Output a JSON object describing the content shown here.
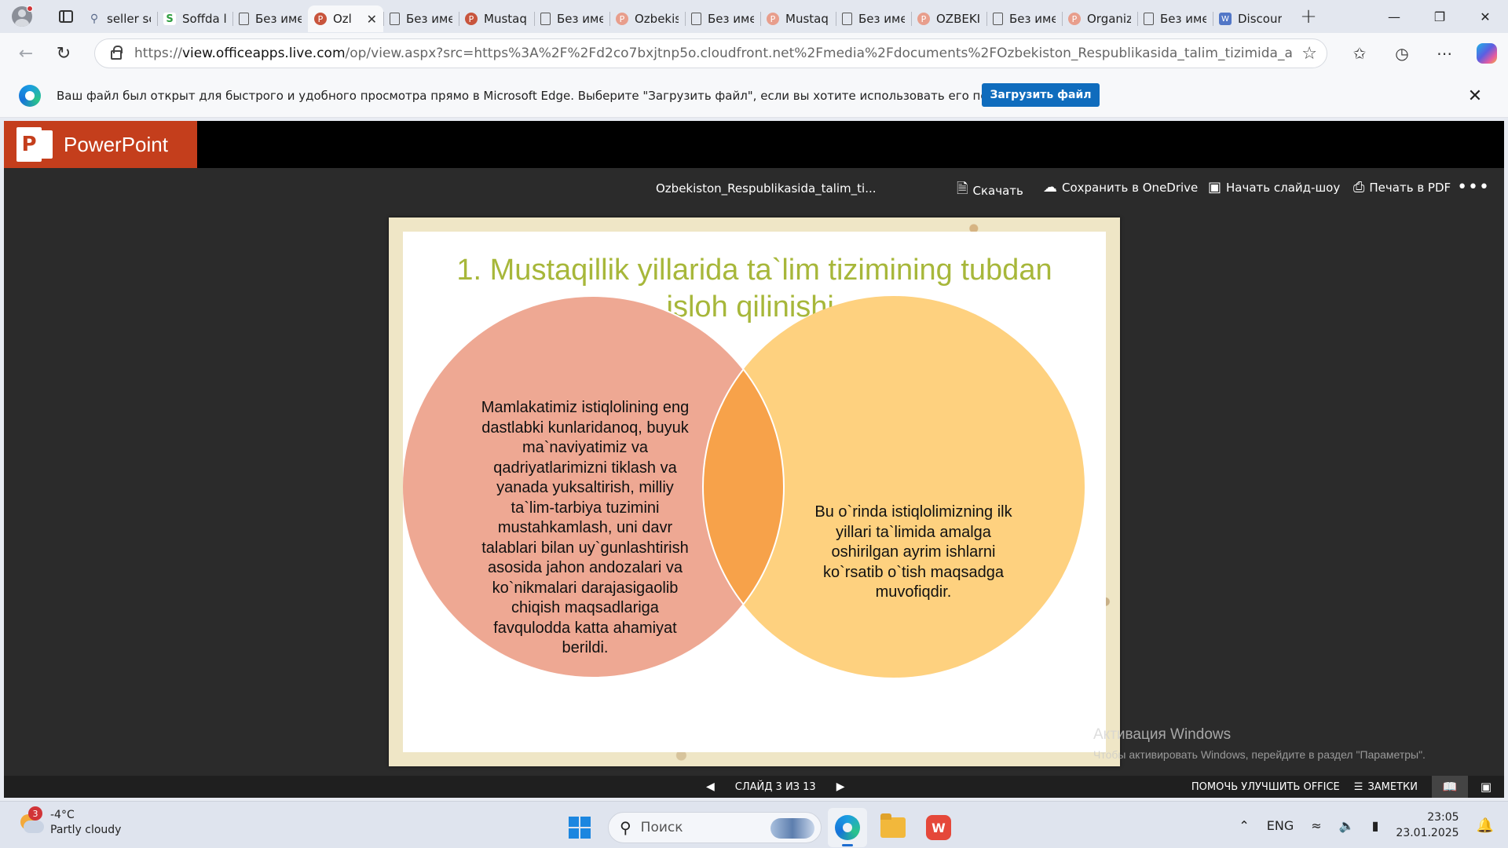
{
  "browser": {
    "tabs": [
      {
        "label": "seller sc",
        "icon": "search"
      },
      {
        "label": "Soffda l",
        "icon": "soffda"
      },
      {
        "label": "Без име",
        "icon": "doc"
      },
      {
        "label": "Ozl",
        "icon": "ppt",
        "active": true
      },
      {
        "label": "Без име",
        "icon": "doc"
      },
      {
        "label": "Mustaq",
        "icon": "ppt"
      },
      {
        "label": "Без име",
        "icon": "doc"
      },
      {
        "label": "Ozbekis",
        "icon": "pptpale"
      },
      {
        "label": "Без име",
        "icon": "doc"
      },
      {
        "label": "Mustaq",
        "icon": "pptpale"
      },
      {
        "label": "Без име",
        "icon": "doc"
      },
      {
        "label": "OZBEKI",
        "icon": "pptpale"
      },
      {
        "label": "Без име",
        "icon": "doc"
      },
      {
        "label": "Organiz",
        "icon": "pptpale"
      },
      {
        "label": "Без име",
        "icon": "doc"
      },
      {
        "label": "Discour",
        "icon": "word"
      }
    ],
    "new_tab": "+",
    "url_prefix": "https://",
    "url_host": "view.officeapps.live.com",
    "url_rest": "/op/view.aspx?src=https%3A%2F%2Fd2co7bxjtnp5o.cloudfront.net%2Fmedia%2Fdocuments%2FOzbekiston_Respublikasida_talim_tizimida_amalga_oshiril..."
  },
  "infobar": {
    "message": "Ваш файл был открыт для быстрого и удобного просмотра прямо в Microsoft Edge. Выберите \"Загрузить файл\", если вы хотите использовать его позже.",
    "button": "Загрузить файл"
  },
  "ppt": {
    "app_name": "PowerPoint",
    "doc_name": "Ozbekiston_Respublikasida_talim_ti...",
    "actions": {
      "download": "Скачать",
      "onedrive": "Сохранить в OneDrive",
      "slideshow": "Начать слайд-шоу",
      "print": "Печать в PDF"
    },
    "slide": {
      "title_line1": "1. Mustaqillik yillarida ta`lim tizimining tubdan",
      "title_line2": "isloh qilinishi.",
      "left_text": "Mamlakatimiz istiqlolining eng dastlabki kunlaridanoq, buyuk ma`naviyatimiz va qadriyatlarimizni tiklash va yanada yuksaltirish, milliy ta`lim-tarbiya tuzimini mustahkamlash, uni davr talablari bilan uy`gunlashtirish asosida jahon andozalari va ko`nikmalari darajasigaolib chiqish maqsadlariga favqulodda katta ahamiyat berildi.",
      "right_text": "Bu o`rinda istiqlolimizning ilk yillari ta`limida amalga oshirilgan ayrim ishlarni ko`rsatib o`tish maqsadga muvofiqdir.",
      "colors": {
        "left": "#eea893",
        "right": "#fed17f",
        "overlap": "#f7a24a",
        "title": "#a7b73a"
      }
    },
    "status": {
      "slide_counter": "СЛАЙД 3 ИЗ 13",
      "help": "ПОМОЧЬ УЛУЧШИТЬ OFFICE",
      "notes": "ЗАМЕТКИ"
    }
  },
  "watermark": {
    "line1": "Активация Windows",
    "line2": "Чтобы активировать Windows, перейдите в раздел \"Параметры\"."
  },
  "taskbar": {
    "weather_badge": "3",
    "temperature": "-4°C",
    "condition": "Partly cloudy",
    "search_placeholder": "Поиск",
    "wps_label": "W",
    "language": "ENG",
    "time": "23:05",
    "date": "23.01.2025"
  }
}
